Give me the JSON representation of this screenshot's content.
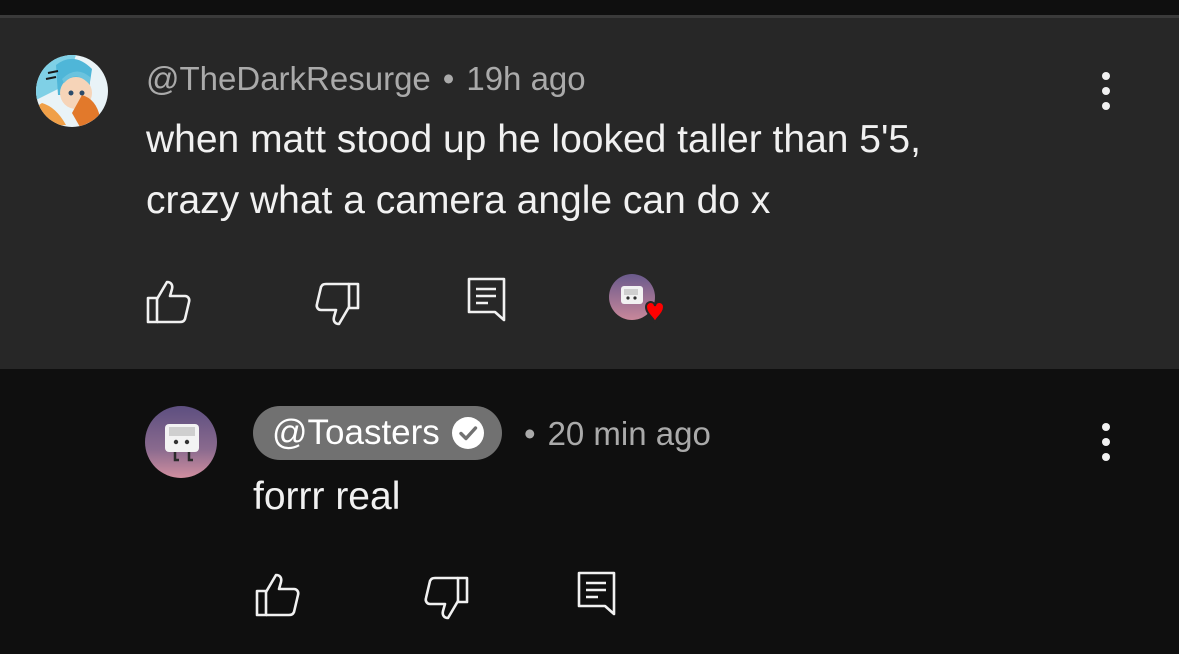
{
  "comment": {
    "author": "@TheDarkResurge",
    "time": "19h ago",
    "text_line1": "when matt stood up he looked taller than 5'5,",
    "text_line2": "crazy what a camera angle can do x",
    "separator": "•",
    "icons": {
      "avatar": "anime-avatar",
      "like": "thumbs-up-icon",
      "dislike": "thumbs-down-icon",
      "reply": "reply-comment-icon",
      "creator_heart": "creator-heart-badge",
      "more": "more-vert-icon"
    }
  },
  "reply": {
    "author": "@Toasters",
    "verified": true,
    "time": "20 min ago",
    "text": "forrr real",
    "separator": "•",
    "icons": {
      "avatar": "toaster-avatar",
      "like": "thumbs-up-icon",
      "dislike": "thumbs-down-icon",
      "reply": "reply-comment-icon",
      "more": "more-vert-icon"
    }
  },
  "colors": {
    "page_bg": "#0f0f0f",
    "highlight_bg": "#272727",
    "meta_text": "#aaaaaa",
    "body_text": "#f1f1f1",
    "pill_bg": "#717171",
    "heart": "#ff0000"
  }
}
